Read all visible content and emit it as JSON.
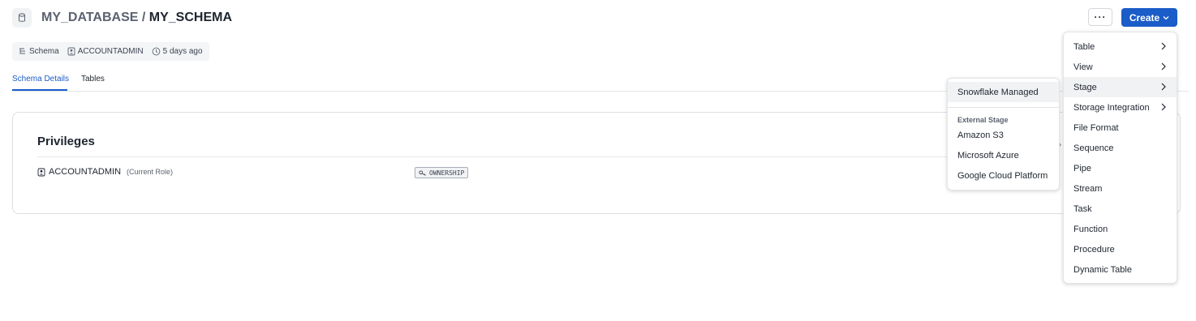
{
  "header": {
    "database": "MY_DATABASE",
    "separator": " / ",
    "schema": "MY_SCHEMA",
    "more_label": "···",
    "create_label": "Create"
  },
  "meta": {
    "type": "Schema",
    "owner": "ACCOUNTADMIN",
    "age": "5 days ago"
  },
  "tabs": [
    {
      "label": "Schema Details",
      "active": true
    },
    {
      "label": "Tables",
      "active": false
    }
  ],
  "privileges": {
    "title": "Privileges",
    "rows": [
      {
        "role": "ACCOUNTADMIN",
        "note": "(Current Role)",
        "privilege": "OWNERSHIP"
      }
    ]
  },
  "create_menu": {
    "items": [
      {
        "label": "Table",
        "has_submenu": true
      },
      {
        "label": "View",
        "has_submenu": true
      },
      {
        "label": "Stage",
        "has_submenu": true,
        "highlighted": true
      },
      {
        "label": "Storage Integration",
        "has_submenu": true
      },
      {
        "label": "File Format"
      },
      {
        "label": "Sequence"
      },
      {
        "label": "Pipe"
      },
      {
        "label": "Stream"
      },
      {
        "label": "Task"
      },
      {
        "label": "Function"
      },
      {
        "label": "Procedure"
      },
      {
        "label": "Dynamic Table"
      }
    ]
  },
  "stage_submenu": {
    "managed": "Snowflake Managed",
    "external_header": "External Stage",
    "external": [
      "Amazon S3",
      "Microsoft Azure",
      "Google Cloud Platform"
    ]
  },
  "peek_glyph": "›",
  "colors": {
    "accent": "#1a5cc8",
    "text": "#1e252f",
    "muted": "#5b6270",
    "highlight": "#f1f2f4"
  }
}
